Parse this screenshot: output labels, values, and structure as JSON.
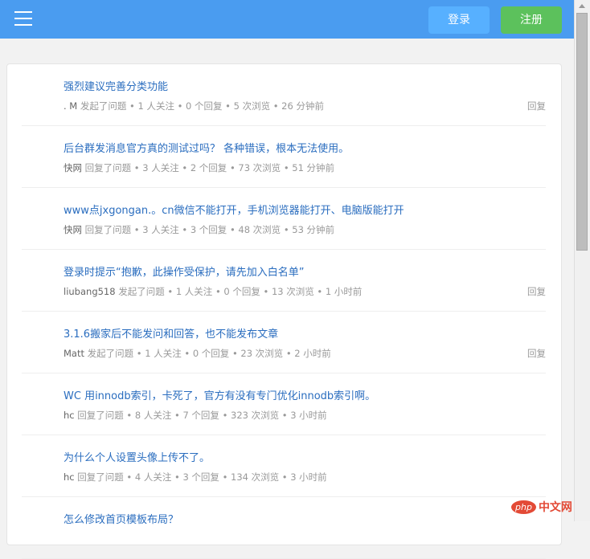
{
  "header": {
    "login_label": "登录",
    "register_label": "注册"
  },
  "questions": [
    {
      "title": "强烈建议完善分类功能",
      "user": ". M",
      "action": "发起了问题",
      "meta": " • 1 人关注 • 0 个回复 • 5 次浏览 • 26 分钟前",
      "reply": "回复"
    },
    {
      "title": "后台群发消息官方真的测试过吗？ 各种错误，根本无法使用。",
      "user": "快网",
      "action": "回复了问题",
      "meta": " • 3 人关注 • 2 个回复 • 73 次浏览 • 51 分钟前",
      "reply": ""
    },
    {
      "title": "www点jxgongan.。cn微信不能打开，手机浏览器能打开、电脑版能打开",
      "user": "快网",
      "action": "回复了问题",
      "meta": " • 3 人关注 • 3 个回复 • 48 次浏览 • 53 分钟前",
      "reply": ""
    },
    {
      "title": "登录时提示“抱歉，此操作受保护，请先加入白名单”",
      "user": "liubang518",
      "action": "发起了问题",
      "meta": " • 1 人关注 • 0 个回复 • 13 次浏览 • 1 小时前",
      "reply": "回复"
    },
    {
      "title": "3.1.6搬家后不能发问和回答，也不能发布文章",
      "user": "Matt",
      "action": "发起了问题",
      "meta": " • 1 人关注 • 0 个回复 • 23 次浏览 • 2 小时前",
      "reply": "回复"
    },
    {
      "title": "WC 用innodb索引，卡死了，官方有没有专门优化innodb索引啊。",
      "user": "hc",
      "action": "回复了问题",
      "meta": " • 8 人关注 • 7 个回复 • 323 次浏览 • 3 小时前",
      "reply": ""
    },
    {
      "title": "为什么个人设置头像上传不了。",
      "user": "hc",
      "action": "回复了问题",
      "meta": " • 4 人关注 • 3 个回复 • 134 次浏览 • 3 小时前",
      "reply": ""
    },
    {
      "title": "怎么修改首页模板布局？",
      "user": "",
      "action": "",
      "meta": "",
      "reply": ""
    }
  ],
  "watermark": {
    "php": "php",
    "cn": "中文网"
  }
}
